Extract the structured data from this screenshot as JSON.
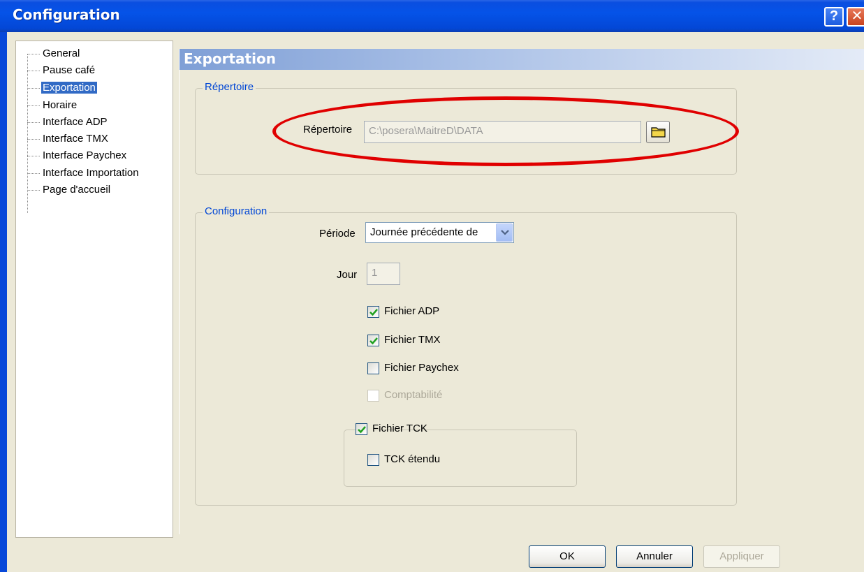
{
  "window": {
    "title": "Configuration",
    "help_glyph": "?",
    "close_glyph": "✕"
  },
  "tree": {
    "items": [
      {
        "label": "General",
        "selected": false
      },
      {
        "label": "Pause café",
        "selected": false
      },
      {
        "label": "Exportation",
        "selected": true
      },
      {
        "label": "Horaire",
        "selected": false
      },
      {
        "label": "Interface ADP",
        "selected": false
      },
      {
        "label": "Interface TMX",
        "selected": false
      },
      {
        "label": "Interface Paychex",
        "selected": false
      },
      {
        "label": "Interface Importation",
        "selected": false
      },
      {
        "label": "Page d'accueil",
        "selected": false
      }
    ]
  },
  "page": {
    "header": "Exportation",
    "repertoire_group": {
      "legend": "Répertoire",
      "label": "Répertoire",
      "value": "C:\\posera\\MaitreD\\DATA",
      "browse_icon": "folder-icon"
    },
    "config_group": {
      "legend": "Configuration",
      "periode_label": "Période",
      "periode_value": "Journée précédente de",
      "jour_label": "Jour",
      "jour_value": "1",
      "checks": [
        {
          "label": "Fichier ADP",
          "checked": true,
          "enabled": true
        },
        {
          "label": "Fichier TMX",
          "checked": true,
          "enabled": true
        },
        {
          "label": "Fichier Paychex",
          "checked": false,
          "enabled": true
        },
        {
          "label": "Comptabilité",
          "checked": false,
          "enabled": false
        }
      ],
      "tck": {
        "label": "Fichier TCK",
        "checked": true,
        "extended_label": "TCK étendu",
        "extended_checked": false
      }
    }
  },
  "buttons": {
    "ok": "OK",
    "cancel": "Annuler",
    "apply": "Appliquer"
  },
  "colors": {
    "titlebar": "#0553e8",
    "selection": "#316ac5",
    "highlight": "#e00000"
  }
}
